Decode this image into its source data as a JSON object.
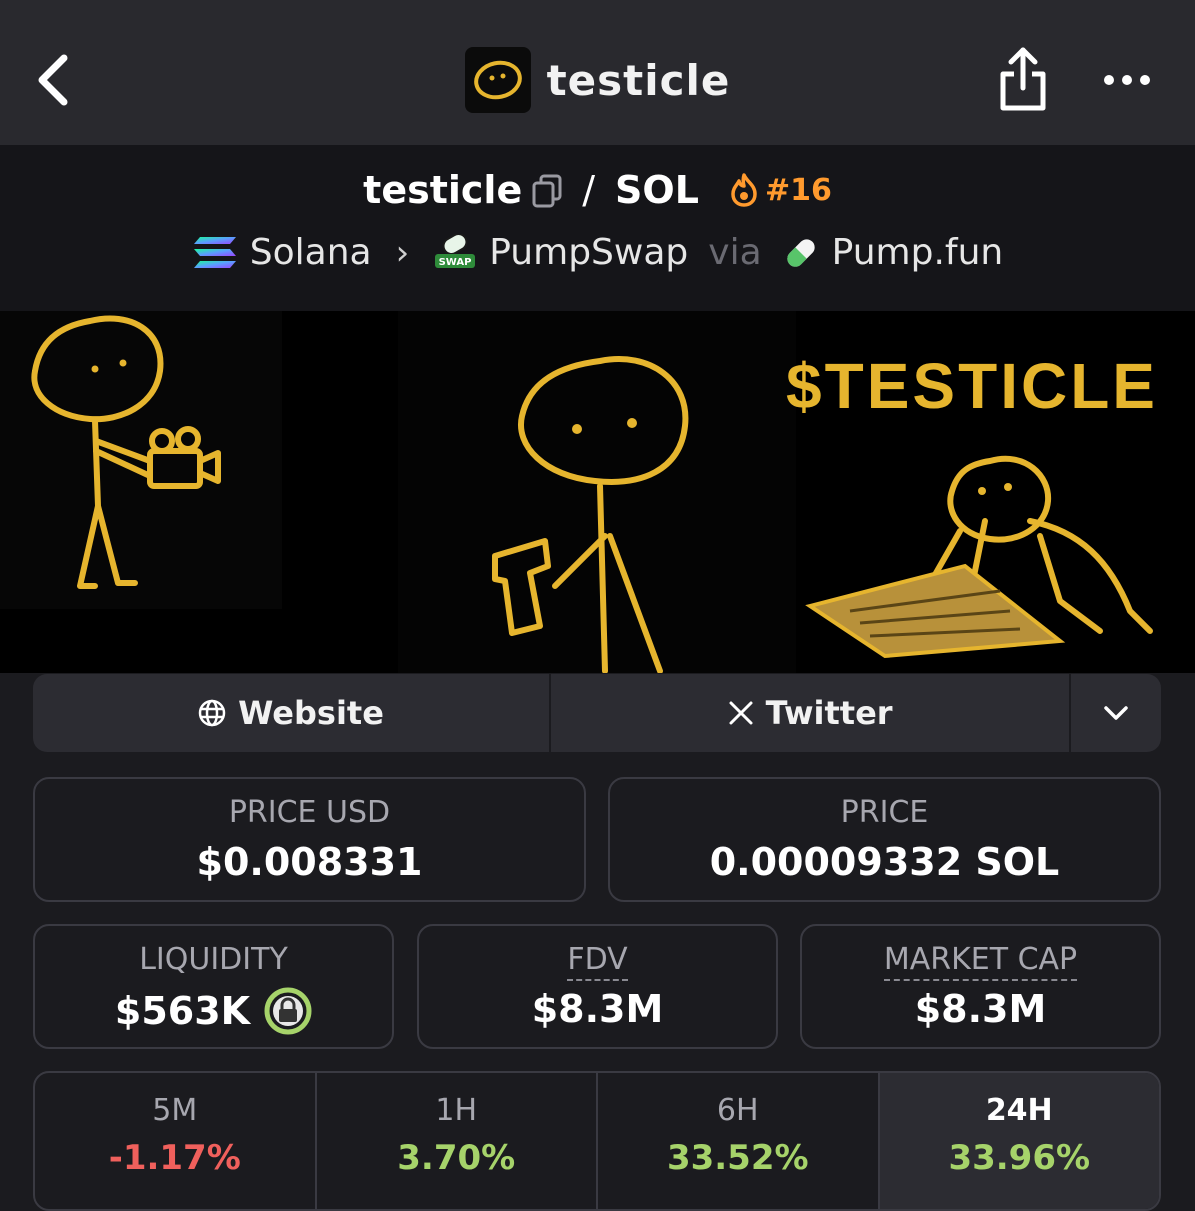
{
  "header": {
    "title": "testicle"
  },
  "pair": {
    "base": "testicle",
    "quote": "SOL",
    "rank": "#16"
  },
  "route": {
    "chain": "Solana",
    "dex": "PumpSwap",
    "via": "via",
    "launchpad": "Pump.fun",
    "dex_badge": "SWAP"
  },
  "banner": {
    "ticker_text": "$TESTICLE"
  },
  "links": {
    "website": "Website",
    "twitter": "Twitter"
  },
  "stats": {
    "price_usd": {
      "label": "PRICE USD",
      "value": "$0.008331"
    },
    "price": {
      "label": "PRICE",
      "value": "0.00009332 SOL"
    },
    "liquidity": {
      "label": "LIQUIDITY",
      "value": "$563K"
    },
    "fdv": {
      "label": "FDV",
      "value": "$8.3M"
    },
    "market_cap": {
      "label": "MARKET CAP",
      "value": "$8.3M"
    }
  },
  "changes": [
    {
      "label": "5M",
      "value": "-1.17%"
    },
    {
      "label": "1H",
      "value": "3.70%"
    },
    {
      "label": "6H",
      "value": "33.52%"
    },
    {
      "label": "24H",
      "value": "33.96%"
    }
  ],
  "colors": {
    "accent_gold": "#e6b52e",
    "positive": "#a6d36a",
    "negative": "#f0605c",
    "rank": "#ff9a2e",
    "lock": "#a6d36a"
  }
}
